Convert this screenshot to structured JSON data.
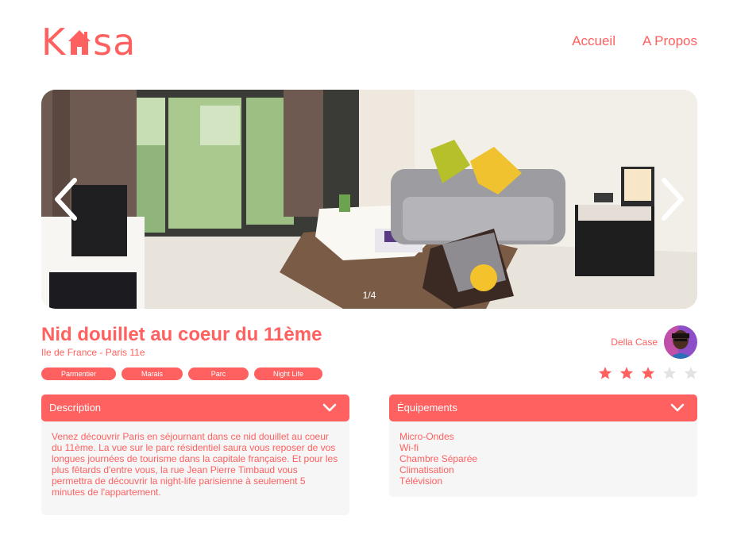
{
  "header": {
    "logo_text_start": "K",
    "logo_text_end": "sa",
    "nav": {
      "home": "Accueil",
      "about": "A Propos"
    }
  },
  "gallery": {
    "counter": "1/4",
    "prev_icon": "chevron-left-icon",
    "next_icon": "chevron-right-icon"
  },
  "listing": {
    "title": "Nid douillet au coeur du 11ème",
    "location": "Ile de France - Paris 11e",
    "tags": [
      "Parmentier",
      "Marais",
      "Parc",
      "Night Life"
    ],
    "host_name": "Della Case",
    "rating": 3,
    "rating_max": 5
  },
  "description": {
    "label": "Description",
    "text": "Venez découvrir Paris en séjournant dans ce nid douillet au coeur du 11ème. La vue sur le parc résidentiel saura vous reposer de vos longues journées de tourisme dans la capitale française. Et pour les plus fêtards d'entre vous, la rue Jean Pierre Timbaud vous permettra de découvrir la night-life parisienne à seulement 5 minutes de l'appartement."
  },
  "equipment": {
    "label": "Équipements",
    "items": [
      "Micro-Ondes",
      "Wi-fi",
      "Chambre Séparée",
      "Climatisation",
      "Télévision"
    ]
  },
  "colors": {
    "accent": "#FF6060",
    "panel_bg": "#F6F6F6",
    "star_off": "#E3E3E3"
  }
}
